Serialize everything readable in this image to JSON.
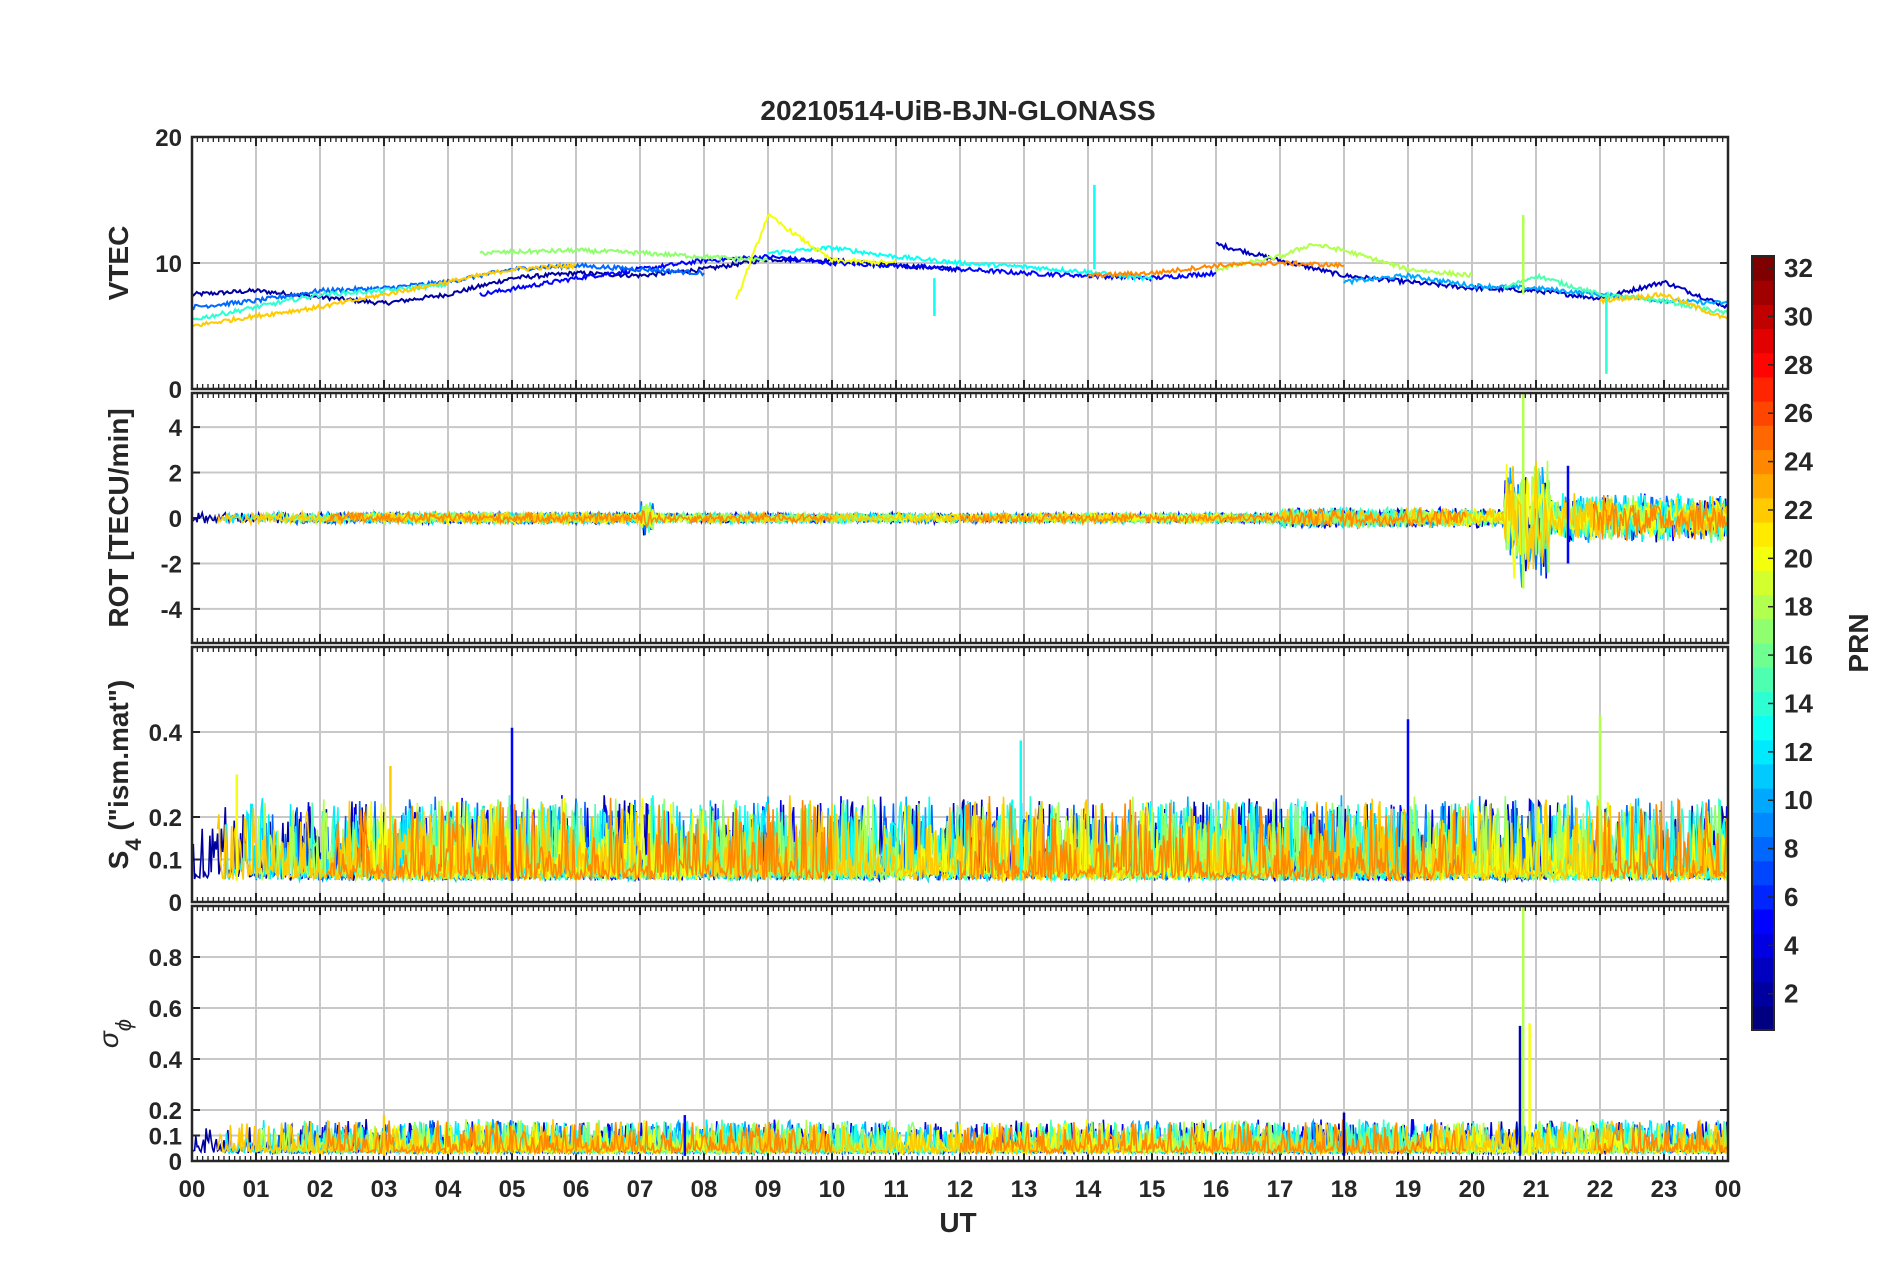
{
  "figure": {
    "title": "20210514-UiB-BJN-GLONASS",
    "xlabel": "UT",
    "x_ticks": [
      "00",
      "01",
      "02",
      "03",
      "04",
      "05",
      "06",
      "07",
      "08",
      "09",
      "10",
      "11",
      "12",
      "13",
      "14",
      "15",
      "16",
      "17",
      "18",
      "19",
      "20",
      "21",
      "22",
      "23",
      "00"
    ],
    "colorbar": {
      "label": "PRN",
      "ticks": [
        "2",
        "4",
        "6",
        "8",
        "10",
        "12",
        "14",
        "16",
        "18",
        "20",
        "22",
        "24",
        "26",
        "28",
        "30",
        "32"
      ],
      "range": [
        1,
        32
      ],
      "colormap": "jet"
    }
  },
  "chart_data": [
    {
      "type": "line",
      "panel": "VTEC",
      "ylabel": "VTEC",
      "xlim": [
        0,
        24
      ],
      "ylim": [
        0,
        20
      ],
      "y_ticks": [
        "0",
        "10",
        "20"
      ],
      "y_tick_values": [
        0,
        10,
        20
      ],
      "grid": true,
      "series": [
        {
          "prn": 2,
          "x": [
            0,
            1,
            2,
            3,
            4,
            5,
            6,
            7,
            8,
            9,
            10,
            11,
            12
          ],
          "y": [
            7.5,
            7.8,
            7.3,
            6.8,
            7.5,
            8.8,
            9.2,
            9.0,
            9.5,
            10.3,
            10.2,
            9.8,
            9.5
          ]
        },
        {
          "prn": 3,
          "x": [
            16,
            17,
            18,
            19,
            20,
            21,
            22,
            23,
            24
          ],
          "y": [
            11.5,
            10.2,
            9.0,
            8.5,
            8.0,
            7.8,
            7.2,
            8.5,
            6.5
          ]
        },
        {
          "prn": 5,
          "x": [
            4.5,
            6,
            7,
            8,
            9,
            10,
            11,
            12,
            13,
            14,
            15,
            16
          ],
          "y": [
            7.5,
            8.8,
            9.5,
            10.2,
            10.5,
            10.0,
            9.8,
            9.5,
            9.2,
            9.0,
            8.8,
            9.2
          ]
        },
        {
          "prn": 8,
          "x": [
            0,
            1,
            2,
            3,
            4,
            5,
            6,
            7,
            8
          ],
          "y": [
            6.5,
            7.0,
            7.8,
            8.0,
            8.5,
            9.5,
            9.8,
            9.5,
            9.2
          ]
        },
        {
          "prn": 10,
          "x": [
            18,
            19,
            20,
            21,
            22,
            23,
            24
          ],
          "y": [
            8.5,
            9.0,
            8.2,
            8.0,
            7.5,
            7.0,
            6.8
          ]
        },
        {
          "prn": 13,
          "x": [
            9,
            10,
            11,
            12,
            13,
            14,
            15
          ],
          "y": [
            10.8,
            11.2,
            10.5,
            10.0,
            9.7,
            9.3,
            8.7
          ]
        },
        {
          "prn": 14,
          "x": [
            0,
            1,
            2,
            3,
            4
          ],
          "y": [
            5.5,
            6.5,
            7.5,
            7.8,
            8.3
          ]
        },
        {
          "prn": 15,
          "x": [
            20.5,
            21,
            22,
            23,
            24
          ],
          "y": [
            8.0,
            9.0,
            7.5,
            7.0,
            6.0
          ]
        },
        {
          "prn": 17,
          "x": [
            4.5,
            6,
            7,
            8,
            9
          ],
          "y": [
            10.8,
            11.0,
            10.8,
            10.5,
            10.2
          ]
        },
        {
          "prn": 18,
          "x": [
            16,
            17,
            17.5,
            18,
            19,
            20
          ],
          "y": [
            9.5,
            10.5,
            11.5,
            11.0,
            9.5,
            9.0
          ]
        },
        {
          "prn": 20,
          "x": [
            8.5,
            9,
            9.5,
            10,
            11
          ],
          "y": [
            7.0,
            13.8,
            12.0,
            10.2,
            10.0
          ]
        },
        {
          "prn": 22,
          "x": [
            0,
            1,
            2,
            3,
            4,
            5,
            6
          ],
          "y": [
            5.0,
            5.8,
            6.5,
            7.5,
            8.5,
            9.5,
            9.8
          ]
        },
        {
          "prn": 22,
          "x": [
            22,
            23,
            24
          ],
          "y": [
            7.0,
            7.5,
            5.5
          ]
        },
        {
          "prn": 24,
          "x": [
            14,
            15,
            16,
            17,
            18
          ],
          "y": [
            9.0,
            9.2,
            9.8,
            10.0,
            9.8
          ]
        }
      ],
      "spikes": [
        {
          "prn": 13,
          "x": 14.1,
          "y": [
            9.5,
            16.2
          ]
        },
        {
          "prn": 13,
          "x": 11.6,
          "y": [
            5.8,
            8.8
          ]
        },
        {
          "prn": 18,
          "x": 20.8,
          "y": [
            7.5,
            13.8
          ]
        },
        {
          "prn": 14,
          "x": 22.1,
          "y": [
            1.2,
            7.5
          ]
        }
      ]
    },
    {
      "type": "line",
      "panel": "ROT",
      "ylabel": "ROT [TECU/min]",
      "xlim": [
        0,
        24
      ],
      "ylim": [
        -5.5,
        5.5
      ],
      "y_ticks": [
        "-4",
        "-2",
        "0",
        "2",
        "4"
      ],
      "y_tick_values": [
        -4,
        -2,
        0,
        2,
        4
      ],
      "grid": true,
      "baseline": 0,
      "noise": [
        {
          "x": [
            0,
            7
          ],
          "amp": 0.4
        },
        {
          "x": [
            7,
            7.2
          ],
          "amp": 1.2
        },
        {
          "x": [
            7.2,
            17
          ],
          "amp": 0.35
        },
        {
          "x": [
            17,
            20.5
          ],
          "amp": 0.7
        },
        {
          "x": [
            20.5,
            21.2
          ],
          "amp": 4.5
        },
        {
          "x": [
            21.2,
            24
          ],
          "amp": 1.6
        }
      ],
      "spikes": [
        {
          "prn": 18,
          "x": 20.8,
          "y": [
            -3.1,
            5.5
          ]
        },
        {
          "prn": 5,
          "x": 21.5,
          "y": [
            -2.0,
            2.3
          ]
        }
      ]
    },
    {
      "type": "line",
      "panel": "S4",
      "ylabel": "S4 (\"ism.mat\")",
      "ylabel_main": "S",
      "ylabel_sub": "4",
      "ylabel_rest": " (\"ism.mat\")",
      "xlim": [
        0,
        24
      ],
      "ylim": [
        0,
        0.6
      ],
      "y_ticks": [
        "0",
        "0.1",
        "0.2",
        "0.4"
      ],
      "y_tick_values": [
        0,
        0.1,
        0.2,
        0.4
      ],
      "grid": true,
      "baseline": 0.05,
      "noise": [
        {
          "x": [
            0,
            24
          ],
          "amp": 0.15
        }
      ],
      "spikes": [
        {
          "prn": 5,
          "x": 5.0,
          "y": [
            0.05,
            0.41
          ]
        },
        {
          "prn": 5,
          "x": 19.0,
          "y": [
            0.05,
            0.43
          ]
        },
        {
          "prn": 18,
          "x": 22.0,
          "y": [
            0.05,
            0.44
          ]
        },
        {
          "prn": 13,
          "x": 12.95,
          "y": [
            0.05,
            0.38
          ]
        },
        {
          "prn": 22,
          "x": 3.1,
          "y": [
            0.05,
            0.32
          ]
        },
        {
          "prn": 20,
          "x": 0.7,
          "y": [
            0.05,
            0.3
          ]
        }
      ]
    },
    {
      "type": "line",
      "panel": "SigmaPhi",
      "ylabel": "σ ϕ",
      "ylabel_main": "σ",
      "ylabel_sub": "ϕ",
      "xlim": [
        0,
        24
      ],
      "ylim": [
        0,
        1.0
      ],
      "y_ticks": [
        "0",
        "0.1",
        "0.2",
        "0.4",
        "0.6",
        "0.8"
      ],
      "y_tick_values": [
        0,
        0.1,
        0.2,
        0.4,
        0.6,
        0.8
      ],
      "grid": true,
      "baseline": 0.03,
      "noise": [
        {
          "x": [
            0,
            24
          ],
          "amp": 0.1
        }
      ],
      "spikes": [
        {
          "prn": 18,
          "x": 20.8,
          "y": [
            0.02,
            1.0
          ]
        },
        {
          "prn": 20,
          "x": 20.9,
          "y": [
            0.02,
            0.54
          ]
        },
        {
          "prn": 3,
          "x": 20.75,
          "y": [
            0.02,
            0.53
          ]
        },
        {
          "prn": 5,
          "x": 7.7,
          "y": [
            0.02,
            0.18
          ]
        },
        {
          "prn": 2,
          "x": 18.0,
          "y": [
            0.02,
            0.19
          ]
        },
        {
          "prn": 22,
          "x": 3.0,
          "y": [
            0.02,
            0.18
          ]
        }
      ]
    }
  ]
}
